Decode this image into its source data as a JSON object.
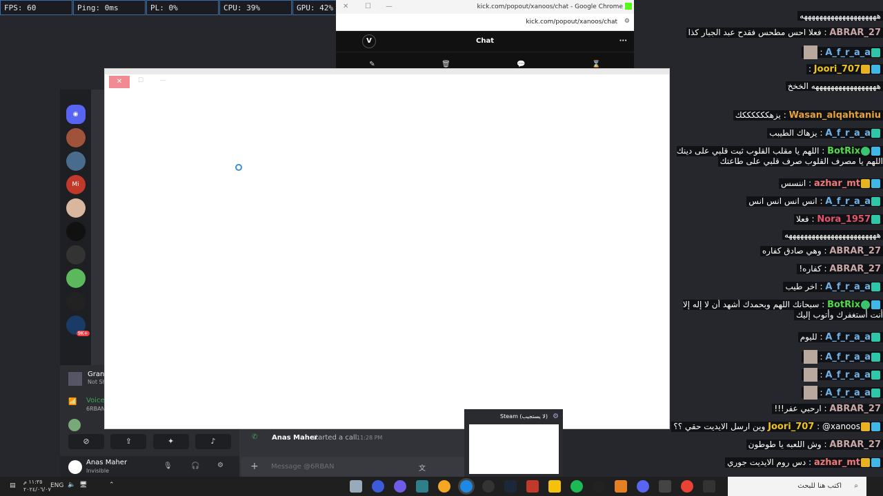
{
  "stats": [
    {
      "label": "FPS: 60"
    },
    {
      "label": "Ping: 0ms"
    },
    {
      "label": "PL: 0%"
    },
    {
      "label": "CPU: 39%"
    },
    {
      "label": "GPU: 42%"
    }
  ],
  "chrome": {
    "window_title": "kick.com/popout/xanoos/chat - Google Chrome",
    "url": "kick.com/popout/xanoos/chat",
    "chat_title": "Chat",
    "logo": "V",
    "more": "···"
  },
  "discord": {
    "voice_label": "Voice",
    "voice_channel": "6RBAN",
    "game_title": "Grand",
    "game_sub": "Not Sh",
    "user_name": "Anas Maher",
    "user_status": "Invisible",
    "call_user": "Anas Maher",
    "call_text": "started a call.",
    "call_time": "11:28 PM",
    "message_placeholder": "Message @6RBAN",
    "badge_count": "9K+"
  },
  "chat": [
    {
      "user": "",
      "text": "ههههههههههههههههههههه"
    },
    {
      "user": "ABRAR_27",
      "color": "#c9a7a7",
      "text": "فعلا احس مطحس فقدح عبد الجبار كذا"
    },
    {
      "user": "A_f_r_a_a",
      "color": "#6fb2e8",
      "text": ""
    },
    {
      "user": "Joori_707",
      "color": "#f0c419",
      "text": ""
    },
    {
      "user": "",
      "text": "هههههههههههههههههه الخخخ"
    },
    {
      "user": "Wasan_alqahtaniu",
      "color": "#e6a33a",
      "text": "يزهككككككك"
    },
    {
      "user": "A_f_r_a_a",
      "color": "#6fb2e8",
      "text": "يزهاك الطيبب"
    },
    {
      "user": "BotRix",
      "color": "#52d94a",
      "text": "اللهم يا مقلب القلوب ثبت قلبي على دينك اللهم يا مصرف القلوب صرف قلبي على طاعتك"
    },
    {
      "user": "azhar_mt",
      "color": "#f07a7a",
      "text": "اننسس"
    },
    {
      "user": "A_f_r_a_a",
      "color": "#6fb2e8",
      "text": "انس انس انس انس"
    },
    {
      "user": "Nora_1957",
      "color": "#e2556a",
      "text": "فعلا"
    },
    {
      "user": "",
      "text": "ههههههههههههههههههههههههه"
    },
    {
      "user": "ABRAR_27",
      "color": "#c9a7a7",
      "text": "وهي صادق كفاره"
    },
    {
      "user": "ABRAR_27",
      "color": "#c9a7a7",
      "text": "كفاره!"
    },
    {
      "user": "A_f_r_a_a",
      "color": "#6fb2e8",
      "text": "اخر طيب"
    },
    {
      "user": "BotRix",
      "color": "#52d94a",
      "text": "سبحانك اللهم وبحمدك أشهد أن لا إله إلا أنت أستغفرك وأتوب إليك"
    },
    {
      "user": "A_f_r_a_a",
      "color": "#6fb2e8",
      "text": "لليوم"
    },
    {
      "user": "A_f_r_a_a",
      "color": "#6fb2e8",
      "text": ""
    },
    {
      "user": "A_f_r_a_a",
      "color": "#6fb2e8",
      "text": ""
    },
    {
      "user": "A_f_r_a_a",
      "color": "#6fb2e8",
      "text": ""
    },
    {
      "user": "ABRAR_27",
      "color": "#c9a7a7",
      "text": "ارحبي عفر!!!"
    },
    {
      "user": "Joori_707",
      "color": "#f0c419",
      "text": "@xanoos وين ارسل الايديت حقي ؟؟"
    },
    {
      "user": "ABRAR_27",
      "color": "#c9a7a7",
      "text": "وش اللعبه يا طوطون"
    },
    {
      "user": "azhar_mt",
      "color": "#f07a7a",
      "text": "دس روم الايديت جوري"
    }
  ],
  "steam": {
    "title": "Steam (لا يستجيب)"
  },
  "taskbar": {
    "search_placeholder": "اكتب هنا للبحث",
    "lang": "ENG",
    "time": "١١:٣٥ م",
    "date": "٢٠٢٤/٠٦/٠٧"
  }
}
